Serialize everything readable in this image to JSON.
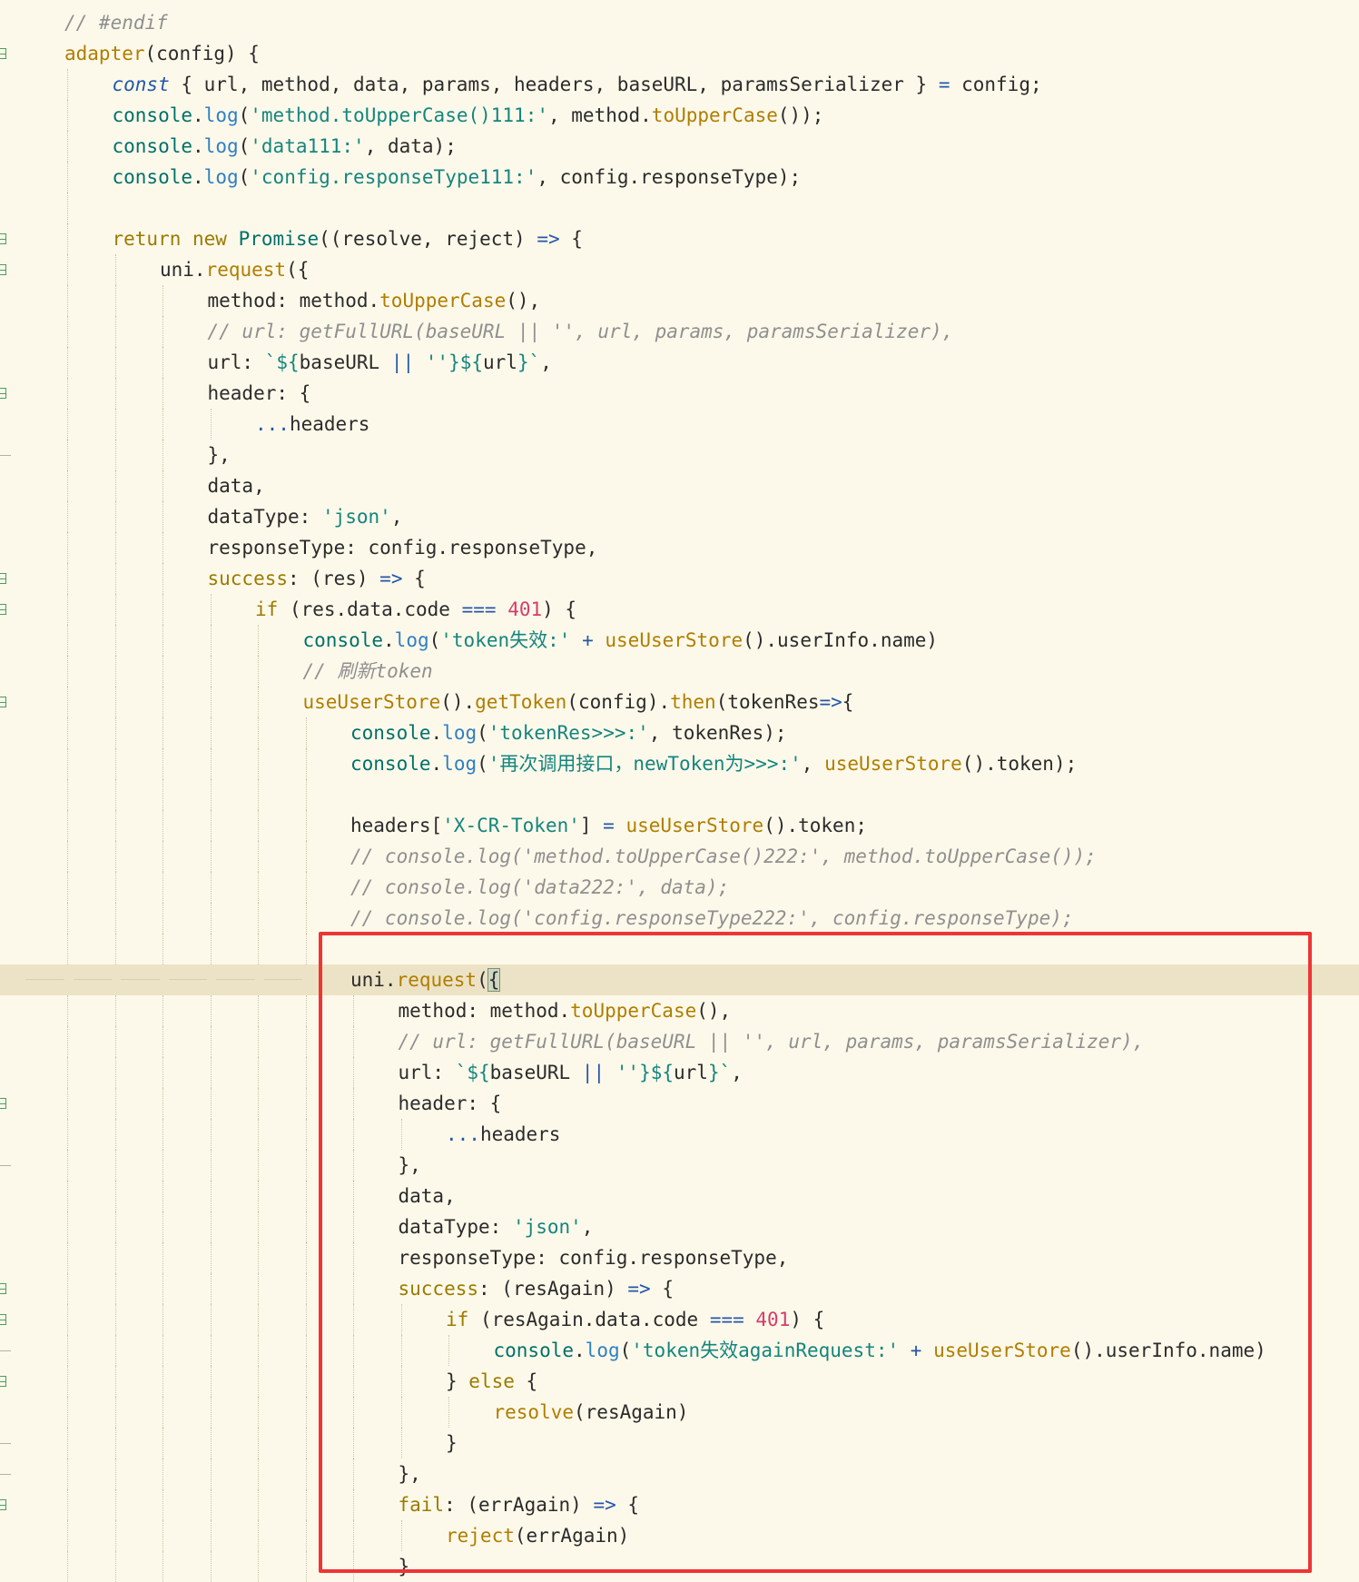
{
  "editor": {
    "lines": [
      {
        "indent": 1,
        "tokens": [
          {
            "t": "cmt",
            "v": "// #endif"
          }
        ]
      },
      {
        "indent": 1,
        "fold": true,
        "tokens": [
          {
            "t": "fn",
            "v": "adapter"
          },
          {
            "t": "plain",
            "v": "(config) {"
          }
        ]
      },
      {
        "indent": 2,
        "tokens": [
          {
            "t": "kwb",
            "v": "const"
          },
          {
            "t": "plain",
            "v": " { url, method, data, params, headers, baseURL, paramsSerializer } "
          },
          {
            "t": "op",
            "v": "="
          },
          {
            "t": "plain",
            "v": " config;"
          }
        ]
      },
      {
        "indent": 2,
        "tokens": [
          {
            "t": "obj",
            "v": "console"
          },
          {
            "t": "plain",
            "v": "."
          },
          {
            "t": "method",
            "v": "log"
          },
          {
            "t": "plain",
            "v": "("
          },
          {
            "t": "str",
            "v": "'method.toUpperCase()111:'"
          },
          {
            "t": "plain",
            "v": ", method."
          },
          {
            "t": "call",
            "v": "toUpperCase"
          },
          {
            "t": "plain",
            "v": "());"
          }
        ]
      },
      {
        "indent": 2,
        "tokens": [
          {
            "t": "obj",
            "v": "console"
          },
          {
            "t": "plain",
            "v": "."
          },
          {
            "t": "method",
            "v": "log"
          },
          {
            "t": "plain",
            "v": "("
          },
          {
            "t": "str",
            "v": "'data111:'"
          },
          {
            "t": "plain",
            "v": ", data);"
          }
        ]
      },
      {
        "indent": 2,
        "tokens": [
          {
            "t": "obj",
            "v": "console"
          },
          {
            "t": "plain",
            "v": "."
          },
          {
            "t": "method",
            "v": "log"
          },
          {
            "t": "plain",
            "v": "("
          },
          {
            "t": "str",
            "v": "'config.responseType111:'"
          },
          {
            "t": "plain",
            "v": ", config.responseType);"
          }
        ]
      },
      {
        "indent": 2,
        "tokens": []
      },
      {
        "indent": 2,
        "fold": true,
        "tokens": [
          {
            "t": "kw",
            "v": "return"
          },
          {
            "t": "plain",
            "v": " "
          },
          {
            "t": "kw",
            "v": "new"
          },
          {
            "t": "plain",
            "v": " "
          },
          {
            "t": "obj",
            "v": "Promise"
          },
          {
            "t": "plain",
            "v": "((resolve, reject) "
          },
          {
            "t": "op",
            "v": "=>"
          },
          {
            "t": "plain",
            "v": " {"
          }
        ]
      },
      {
        "indent": 3,
        "fold": true,
        "tokens": [
          {
            "t": "plain",
            "v": "uni."
          },
          {
            "t": "call",
            "v": "request"
          },
          {
            "t": "plain",
            "v": "({"
          }
        ]
      },
      {
        "indent": 4,
        "tokens": [
          {
            "t": "plain",
            "v": "method: method."
          },
          {
            "t": "call",
            "v": "toUpperCase"
          },
          {
            "t": "plain",
            "v": "(),"
          }
        ]
      },
      {
        "indent": 4,
        "tokens": [
          {
            "t": "cmt",
            "v": "// url: getFullURL(baseURL || '', url, params, paramsSerializer),"
          }
        ]
      },
      {
        "indent": 4,
        "tokens": [
          {
            "t": "plain",
            "v": "url: "
          },
          {
            "t": "tpl",
            "v": "`${"
          },
          {
            "t": "plain",
            "v": "baseURL "
          },
          {
            "t": "op",
            "v": "||"
          },
          {
            "t": "plain",
            "v": " "
          },
          {
            "t": "str",
            "v": "''"
          },
          {
            "t": "tpl",
            "v": "}${"
          },
          {
            "t": "plain",
            "v": "url"
          },
          {
            "t": "tpl",
            "v": "}`"
          },
          {
            "t": "plain",
            "v": ","
          }
        ]
      },
      {
        "indent": 4,
        "fold": true,
        "tokens": [
          {
            "t": "plain",
            "v": "header: {"
          }
        ]
      },
      {
        "indent": 5,
        "tokens": [
          {
            "t": "op",
            "v": "..."
          },
          {
            "t": "plain",
            "v": "headers"
          }
        ]
      },
      {
        "indent": 4,
        "tick": true,
        "tokens": [
          {
            "t": "plain",
            "v": "},"
          }
        ]
      },
      {
        "indent": 4,
        "tokens": [
          {
            "t": "plain",
            "v": "data,"
          }
        ]
      },
      {
        "indent": 4,
        "tokens": [
          {
            "t": "plain",
            "v": "dataType: "
          },
          {
            "t": "str",
            "v": "'json'"
          },
          {
            "t": "plain",
            "v": ","
          }
        ]
      },
      {
        "indent": 4,
        "tokens": [
          {
            "t": "plain",
            "v": "responseType: config.responseType,"
          }
        ]
      },
      {
        "indent": 4,
        "fold": true,
        "tokens": [
          {
            "t": "kw",
            "v": "success"
          },
          {
            "t": "plain",
            "v": ": (res) "
          },
          {
            "t": "op",
            "v": "=>"
          },
          {
            "t": "plain",
            "v": " {"
          }
        ]
      },
      {
        "indent": 5,
        "fold": true,
        "tokens": [
          {
            "t": "kw",
            "v": "if"
          },
          {
            "t": "plain",
            "v": " (res.data.code "
          },
          {
            "t": "op",
            "v": "==="
          },
          {
            "t": "plain",
            "v": " "
          },
          {
            "t": "num",
            "v": "401"
          },
          {
            "t": "plain",
            "v": ") {"
          }
        ]
      },
      {
        "indent": 6,
        "tokens": [
          {
            "t": "obj",
            "v": "console"
          },
          {
            "t": "plain",
            "v": "."
          },
          {
            "t": "method",
            "v": "log"
          },
          {
            "t": "plain",
            "v": "("
          },
          {
            "t": "str",
            "v": "'token失效:'"
          },
          {
            "t": "plain",
            "v": " "
          },
          {
            "t": "op",
            "v": "+"
          },
          {
            "t": "plain",
            "v": " "
          },
          {
            "t": "call",
            "v": "useUserStore"
          },
          {
            "t": "plain",
            "v": "().userInfo.name)"
          }
        ]
      },
      {
        "indent": 6,
        "tokens": [
          {
            "t": "cmt",
            "v": "// 刷新token"
          }
        ]
      },
      {
        "indent": 6,
        "fold": true,
        "tokens": [
          {
            "t": "call",
            "v": "useUserStore"
          },
          {
            "t": "plain",
            "v": "()."
          },
          {
            "t": "call",
            "v": "getToken"
          },
          {
            "t": "plain",
            "v": "(config)."
          },
          {
            "t": "call",
            "v": "then"
          },
          {
            "t": "plain",
            "v": "(tokenRes"
          },
          {
            "t": "op",
            "v": "=>"
          },
          {
            "t": "plain",
            "v": "{"
          }
        ]
      },
      {
        "indent": 7,
        "tokens": [
          {
            "t": "obj",
            "v": "console"
          },
          {
            "t": "plain",
            "v": "."
          },
          {
            "t": "method",
            "v": "log"
          },
          {
            "t": "plain",
            "v": "("
          },
          {
            "t": "str",
            "v": "'tokenRes>>>:'"
          },
          {
            "t": "plain",
            "v": ", tokenRes);"
          }
        ]
      },
      {
        "indent": 7,
        "tokens": [
          {
            "t": "obj",
            "v": "console"
          },
          {
            "t": "plain",
            "v": "."
          },
          {
            "t": "method",
            "v": "log"
          },
          {
            "t": "plain",
            "v": "("
          },
          {
            "t": "str",
            "v": "'再次调用接口，newToken为>>>:'"
          },
          {
            "t": "plain",
            "v": ", "
          },
          {
            "t": "call",
            "v": "useUserStore"
          },
          {
            "t": "plain",
            "v": "().token);"
          }
        ]
      },
      {
        "indent": 7,
        "tokens": []
      },
      {
        "indent": 7,
        "tokens": [
          {
            "t": "plain",
            "v": "headers["
          },
          {
            "t": "str",
            "v": "'X-CR-Token'"
          },
          {
            "t": "plain",
            "v": "] "
          },
          {
            "t": "op",
            "v": "="
          },
          {
            "t": "plain",
            "v": " "
          },
          {
            "t": "call",
            "v": "useUserStore"
          },
          {
            "t": "plain",
            "v": "().token;"
          }
        ]
      },
      {
        "indent": 7,
        "tokens": [
          {
            "t": "cmt",
            "v": "// console.log('method.toUpperCase()222:', method.toUpperCase());"
          }
        ]
      },
      {
        "indent": 7,
        "tokens": [
          {
            "t": "cmt",
            "v": "// console.log('data222:', data);"
          }
        ]
      },
      {
        "indent": 7,
        "tokens": [
          {
            "t": "cmt",
            "v": "// console.log('config.responseType222:', config.responseType);"
          }
        ]
      },
      {
        "indent": 7,
        "tokens": []
      },
      {
        "indent": 7,
        "fold": true,
        "current": true,
        "tokens": [
          {
            "t": "plain",
            "v": "uni."
          },
          {
            "t": "call",
            "v": "request"
          },
          {
            "t": "plain",
            "v": "("
          },
          {
            "t": "caret",
            "v": "{"
          }
        ]
      },
      {
        "indent": 8,
        "tokens": [
          {
            "t": "plain",
            "v": "method: method."
          },
          {
            "t": "call",
            "v": "toUpperCase"
          },
          {
            "t": "plain",
            "v": "(),"
          }
        ]
      },
      {
        "indent": 8,
        "tokens": [
          {
            "t": "cmt",
            "v": "// url: getFullURL(baseURL || '', url, params, paramsSerializer),"
          }
        ]
      },
      {
        "indent": 8,
        "tokens": [
          {
            "t": "plain",
            "v": "url: "
          },
          {
            "t": "tpl",
            "v": "`${"
          },
          {
            "t": "plain",
            "v": "baseURL "
          },
          {
            "t": "op",
            "v": "||"
          },
          {
            "t": "plain",
            "v": " "
          },
          {
            "t": "str",
            "v": "''"
          },
          {
            "t": "tpl",
            "v": "}${"
          },
          {
            "t": "plain",
            "v": "url"
          },
          {
            "t": "tpl",
            "v": "}`"
          },
          {
            "t": "plain",
            "v": ","
          }
        ]
      },
      {
        "indent": 8,
        "fold": true,
        "tokens": [
          {
            "t": "plain",
            "v": "header: {"
          }
        ]
      },
      {
        "indent": 9,
        "tokens": [
          {
            "t": "op",
            "v": "..."
          },
          {
            "t": "plain",
            "v": "headers"
          }
        ]
      },
      {
        "indent": 8,
        "tick": true,
        "tokens": [
          {
            "t": "plain",
            "v": "},"
          }
        ]
      },
      {
        "indent": 8,
        "tokens": [
          {
            "t": "plain",
            "v": "data,"
          }
        ]
      },
      {
        "indent": 8,
        "tokens": [
          {
            "t": "plain",
            "v": "dataType: "
          },
          {
            "t": "str",
            "v": "'json'"
          },
          {
            "t": "plain",
            "v": ","
          }
        ]
      },
      {
        "indent": 8,
        "tokens": [
          {
            "t": "plain",
            "v": "responseType: config.responseType,"
          }
        ]
      },
      {
        "indent": 8,
        "fold": true,
        "tokens": [
          {
            "t": "kw",
            "v": "success"
          },
          {
            "t": "plain",
            "v": ": (resAgain) "
          },
          {
            "t": "op",
            "v": "=>"
          },
          {
            "t": "plain",
            "v": " {"
          }
        ]
      },
      {
        "indent": 9,
        "fold": true,
        "tokens": [
          {
            "t": "kw",
            "v": "if"
          },
          {
            "t": "plain",
            "v": " (resAgain.data.code "
          },
          {
            "t": "op",
            "v": "==="
          },
          {
            "t": "plain",
            "v": " "
          },
          {
            "t": "num",
            "v": "401"
          },
          {
            "t": "plain",
            "v": ") {"
          }
        ]
      },
      {
        "indent": 10,
        "tick": true,
        "tokens": [
          {
            "t": "obj",
            "v": "console"
          },
          {
            "t": "plain",
            "v": "."
          },
          {
            "t": "method",
            "v": "log"
          },
          {
            "t": "plain",
            "v": "("
          },
          {
            "t": "str",
            "v": "'token失效againRequest:'"
          },
          {
            "t": "plain",
            "v": " "
          },
          {
            "t": "op",
            "v": "+"
          },
          {
            "t": "plain",
            "v": " "
          },
          {
            "t": "call",
            "v": "useUserStore"
          },
          {
            "t": "plain",
            "v": "().userInfo.name)"
          }
        ]
      },
      {
        "indent": 9,
        "fold": true,
        "tokens": [
          {
            "t": "plain",
            "v": "} "
          },
          {
            "t": "kw",
            "v": "else"
          },
          {
            "t": "plain",
            "v": " {"
          }
        ]
      },
      {
        "indent": 10,
        "tokens": [
          {
            "t": "call",
            "v": "resolve"
          },
          {
            "t": "plain",
            "v": "(resAgain)"
          }
        ]
      },
      {
        "indent": 9,
        "tick": true,
        "tokens": [
          {
            "t": "plain",
            "v": "}"
          }
        ]
      },
      {
        "indent": 8,
        "tick": true,
        "tokens": [
          {
            "t": "plain",
            "v": "},"
          }
        ]
      },
      {
        "indent": 8,
        "fold": true,
        "tokens": [
          {
            "t": "kw",
            "v": "fail"
          },
          {
            "t": "plain",
            "v": ": (errAgain) "
          },
          {
            "t": "op",
            "v": "=>"
          },
          {
            "t": "plain",
            "v": " {"
          }
        ]
      },
      {
        "indent": 9,
        "tokens": [
          {
            "t": "call",
            "v": "reject"
          },
          {
            "t": "plain",
            "v": "(errAgain)"
          }
        ]
      },
      {
        "indent": 8,
        "tokens": [
          {
            "t": "plain",
            "v": "}"
          }
        ]
      }
    ]
  },
  "annotation": {
    "color": "#ee3535"
  },
  "colors": {
    "background": "#fdf9ea",
    "current_line": "#ece3c6",
    "keyword": "#9a7b00",
    "function_call": "#b07d00",
    "string": "#14857e",
    "number": "#d43d6b",
    "comment": "#8f8f8f",
    "operator": "#2456a8"
  }
}
